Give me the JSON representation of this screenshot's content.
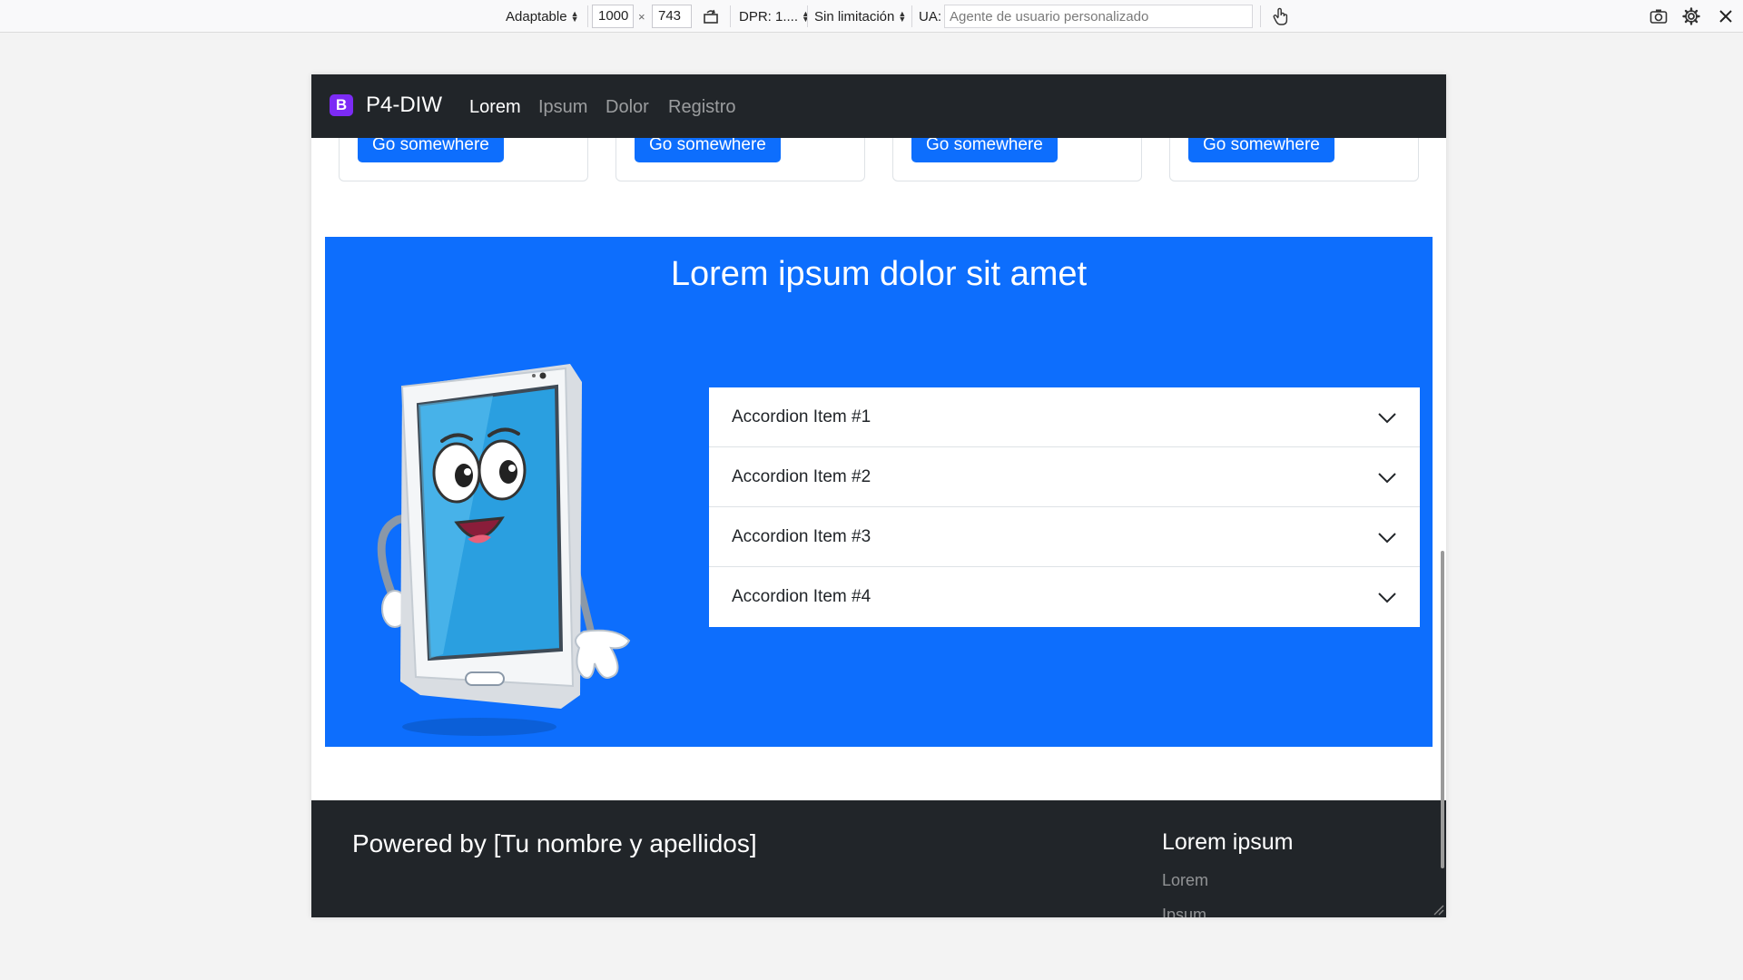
{
  "toolbar": {
    "device": "Adaptable",
    "width": "1000",
    "times": "×",
    "height": "743",
    "dpr": "DPR: 1....",
    "throttle": "Sin limitación",
    "ua_label": "UA:",
    "ua_placeholder": "Agente de usuario personalizado"
  },
  "navbar": {
    "brand_logo": "B",
    "brand": "P4-DIW",
    "links": [
      "Lorem",
      "Ipsum",
      "Dolor",
      "Registro"
    ],
    "active_index": 0
  },
  "cards": [
    {
      "button": "Go somewhere"
    },
    {
      "button": "Go somewhere"
    },
    {
      "button": "Go somewhere"
    },
    {
      "button": "Go somewhere"
    }
  ],
  "section": {
    "title": "Lorem ipsum dolor sit amet",
    "accordion": [
      {
        "label": "Accordion Item #1"
      },
      {
        "label": "Accordion Item #2"
      },
      {
        "label": "Accordion Item #3"
      },
      {
        "label": "Accordion Item #4"
      }
    ]
  },
  "footer": {
    "powered": "Powered by [Tu nombre y apellidos]",
    "heading": "Lorem ipsum",
    "links": [
      "Lorem",
      "Ipsum"
    ]
  },
  "colors": {
    "primary": "#0d6efd",
    "dark": "#212529",
    "brand": "#7c2bf5"
  }
}
